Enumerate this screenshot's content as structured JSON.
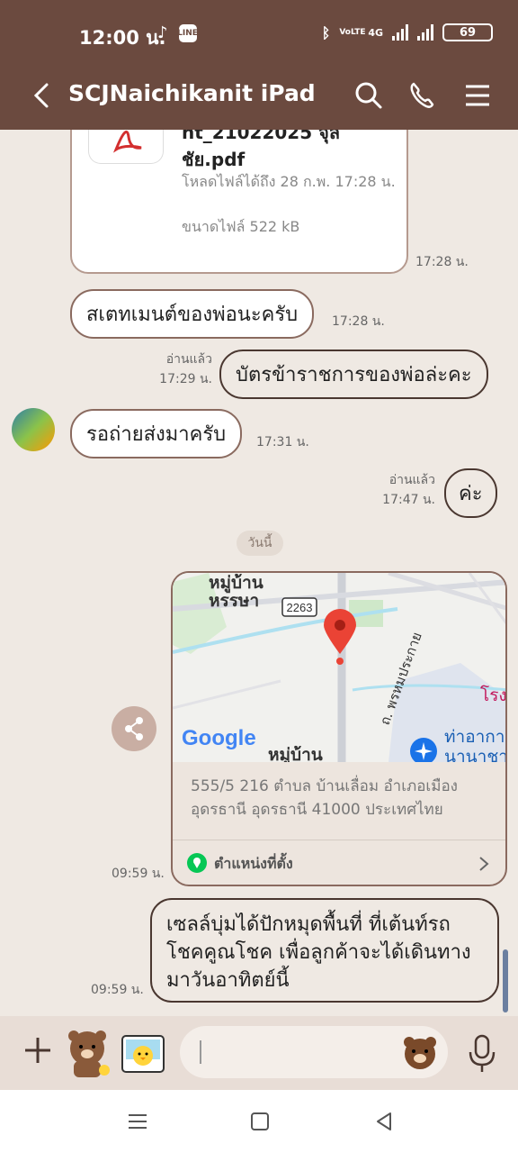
{
  "status_bar": {
    "time": "12:00 น.",
    "battery": "69",
    "network": "4G",
    "volte": "VoLTE"
  },
  "header": {
    "title": "SCJNaichikanit iPad"
  },
  "file_message": {
    "name": "nt_21022025 จุลชัย.pdf",
    "download_info": "โหลดไฟล์ได้ถึง 28 ก.พ. 17:28 น.",
    "size": "ขนาดไฟล์ 522 kB",
    "time": "17:28 น."
  },
  "messages": [
    {
      "text": "สเตทเมนต์ของพ่อนะครับ",
      "time": "17:28 น."
    },
    {
      "text": "บัตรข้าราชการของพ่อล่ะคะ",
      "read": "อ่านแล้ว",
      "time": "17:29 น."
    },
    {
      "text": "รอถ่ายส่งมาครับ",
      "time": "17:31 น."
    },
    {
      "text": "ค่ะ",
      "read": "อ่านแล้ว",
      "time": "17:47 น."
    }
  ],
  "date_separator": "วันนี้",
  "location_message": {
    "map_labels": {
      "village_top": "หมู่บ้าน",
      "village_top2": "หรรษา",
      "road_number": "2263",
      "road_name": "ถ. พรหมประกาย",
      "village_bottom": "หมู่บ้าน",
      "airport": "ท่าอากา",
      "airport2": "นานาชา",
      "hospital": "โรง",
      "google": "Google"
    },
    "address": "555/5 216 ตำบล บ้านเลื่อม อำเภอเมืองอุดรธานี อุดรธานี 41000 ประเทศไทย",
    "label": "ตำแหน่งที่ตั้ง",
    "time": "09:59 น."
  },
  "final_message": {
    "text": "เซลล์บุ่มได้ปักหมุดพื้นที่ ที่เต้นท์รถโชคคูณโชค เพื่อลูกค้าจะได้เดินทางมาวันอาทิตย์นี้",
    "time": "09:59 น."
  },
  "input": {
    "placeholder": ""
  },
  "colors": {
    "brand": "#6b4a3f",
    "bg": "#efe9e3",
    "pin": "#e8383d",
    "loc_green": "#06c755"
  }
}
